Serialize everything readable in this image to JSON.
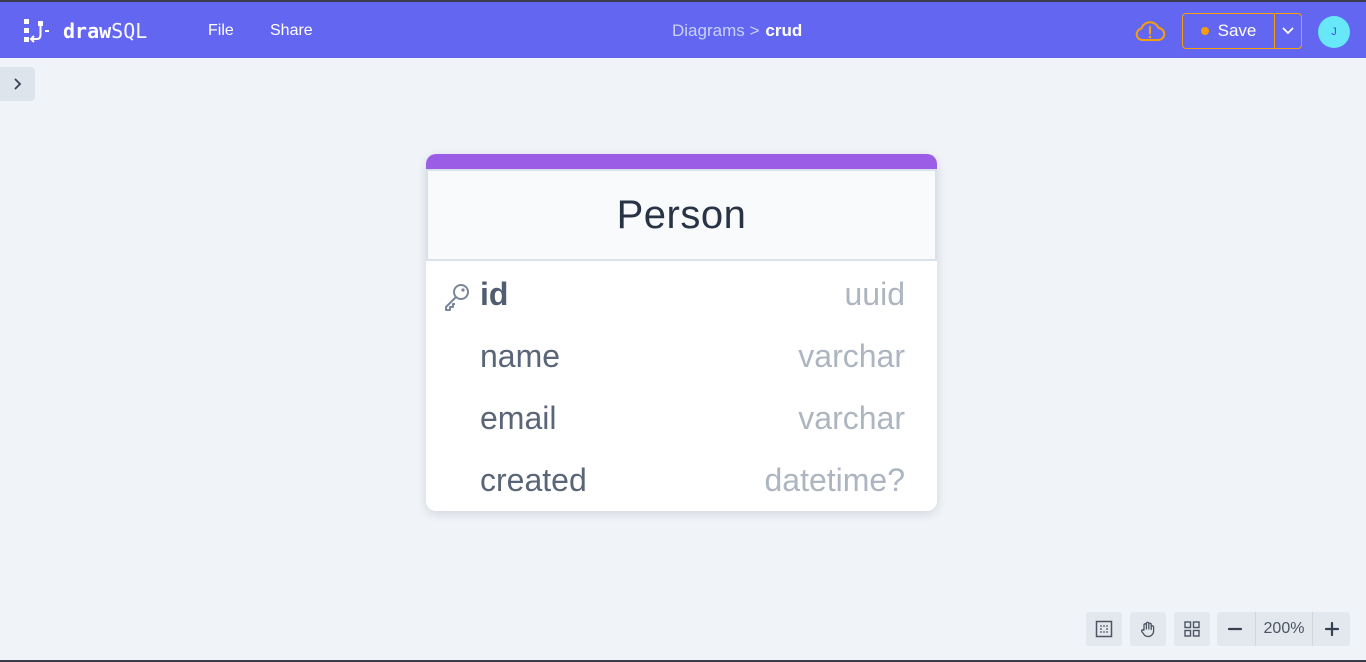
{
  "app": {
    "brand_bold": "draw",
    "brand_light": "SQL",
    "logo_icon": "drawsql-logo-icon"
  },
  "menu": [
    {
      "label": "File"
    },
    {
      "label": "Share"
    }
  ],
  "breadcrumb": {
    "parent": "Diagrams >",
    "current": "crud"
  },
  "header_actions": {
    "cloud_icon": "cloud-warning-icon",
    "save_label": "Save",
    "unsaved_indicator_color": "#f59e0b",
    "avatar_initial": "J"
  },
  "colors": {
    "topbar": "#6366f1",
    "table_accent": "#9b5de5",
    "canvas": "#f0f4f8"
  },
  "table": {
    "name": "Person",
    "fields": [
      {
        "name": "id",
        "type": "uuid",
        "primary_key": true
      },
      {
        "name": "name",
        "type": "varchar",
        "primary_key": false
      },
      {
        "name": "email",
        "type": "varchar",
        "primary_key": false
      },
      {
        "name": "created",
        "type": "datetime?",
        "primary_key": false
      }
    ]
  },
  "toolbar": {
    "tools": [
      "select-area-icon",
      "hand-pan-icon",
      "grid-layout-icon"
    ],
    "zoom_level": "200%"
  }
}
